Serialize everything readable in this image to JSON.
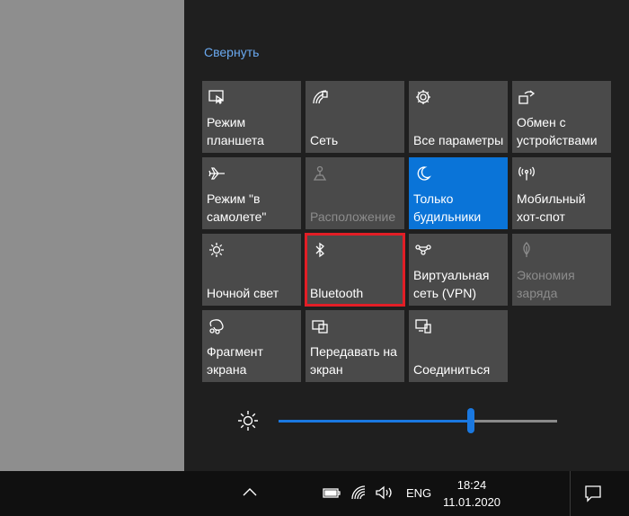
{
  "action_center": {
    "collapse_label": "Свернуть",
    "tiles": [
      {
        "label": "Режим\nпланшета",
        "icon": "tablet-mode-icon",
        "state": "normal"
      },
      {
        "label": "Сеть",
        "icon": "network-icon",
        "state": "normal"
      },
      {
        "label": "Все параметры",
        "icon": "gear-icon",
        "state": "normal"
      },
      {
        "label": "Обмен с\nустройствами",
        "icon": "nearby-sharing-icon",
        "state": "normal"
      },
      {
        "label": "Режим \"в\nсамолете\"",
        "icon": "airplane-icon",
        "state": "normal"
      },
      {
        "label": "Расположение",
        "icon": "location-icon",
        "state": "disabled"
      },
      {
        "label": "Только\nбудильники",
        "icon": "moon-icon",
        "state": "active"
      },
      {
        "label": "Мобильный\nхот-спот",
        "icon": "hotspot-icon",
        "state": "normal"
      },
      {
        "label": "Ночной свет",
        "icon": "night-light-icon",
        "state": "normal"
      },
      {
        "label": "Bluetooth",
        "icon": "bluetooth-icon",
        "state": "highlighted"
      },
      {
        "label": "Виртуальная\nсеть (VPN)",
        "icon": "vpn-icon",
        "state": "normal"
      },
      {
        "label": "Экономия\nзаряда",
        "icon": "battery-saver-icon",
        "state": "disabled"
      },
      {
        "label": "Фрагмент\nэкрана",
        "icon": "snip-icon",
        "state": "normal"
      },
      {
        "label": "Передавать на\nэкран",
        "icon": "project-icon",
        "state": "normal"
      },
      {
        "label": "Соединиться",
        "icon": "connect-icon",
        "state": "normal"
      }
    ],
    "brightness": {
      "icon": "brightness-icon",
      "level": 0.69
    }
  },
  "taskbar": {
    "language": "ENG",
    "time": "18:24",
    "date": "11.01.2020",
    "icons": [
      "chevron-up-icon",
      "battery-icon",
      "wifi-icon",
      "volume-icon",
      "notifications-icon"
    ]
  },
  "colors": {
    "accent": "#0a74d8",
    "tile_bg": "#4a4a4a",
    "panel_bg": "#1f1f1f",
    "highlight": "#e21e26",
    "link": "#6aa9f0"
  }
}
